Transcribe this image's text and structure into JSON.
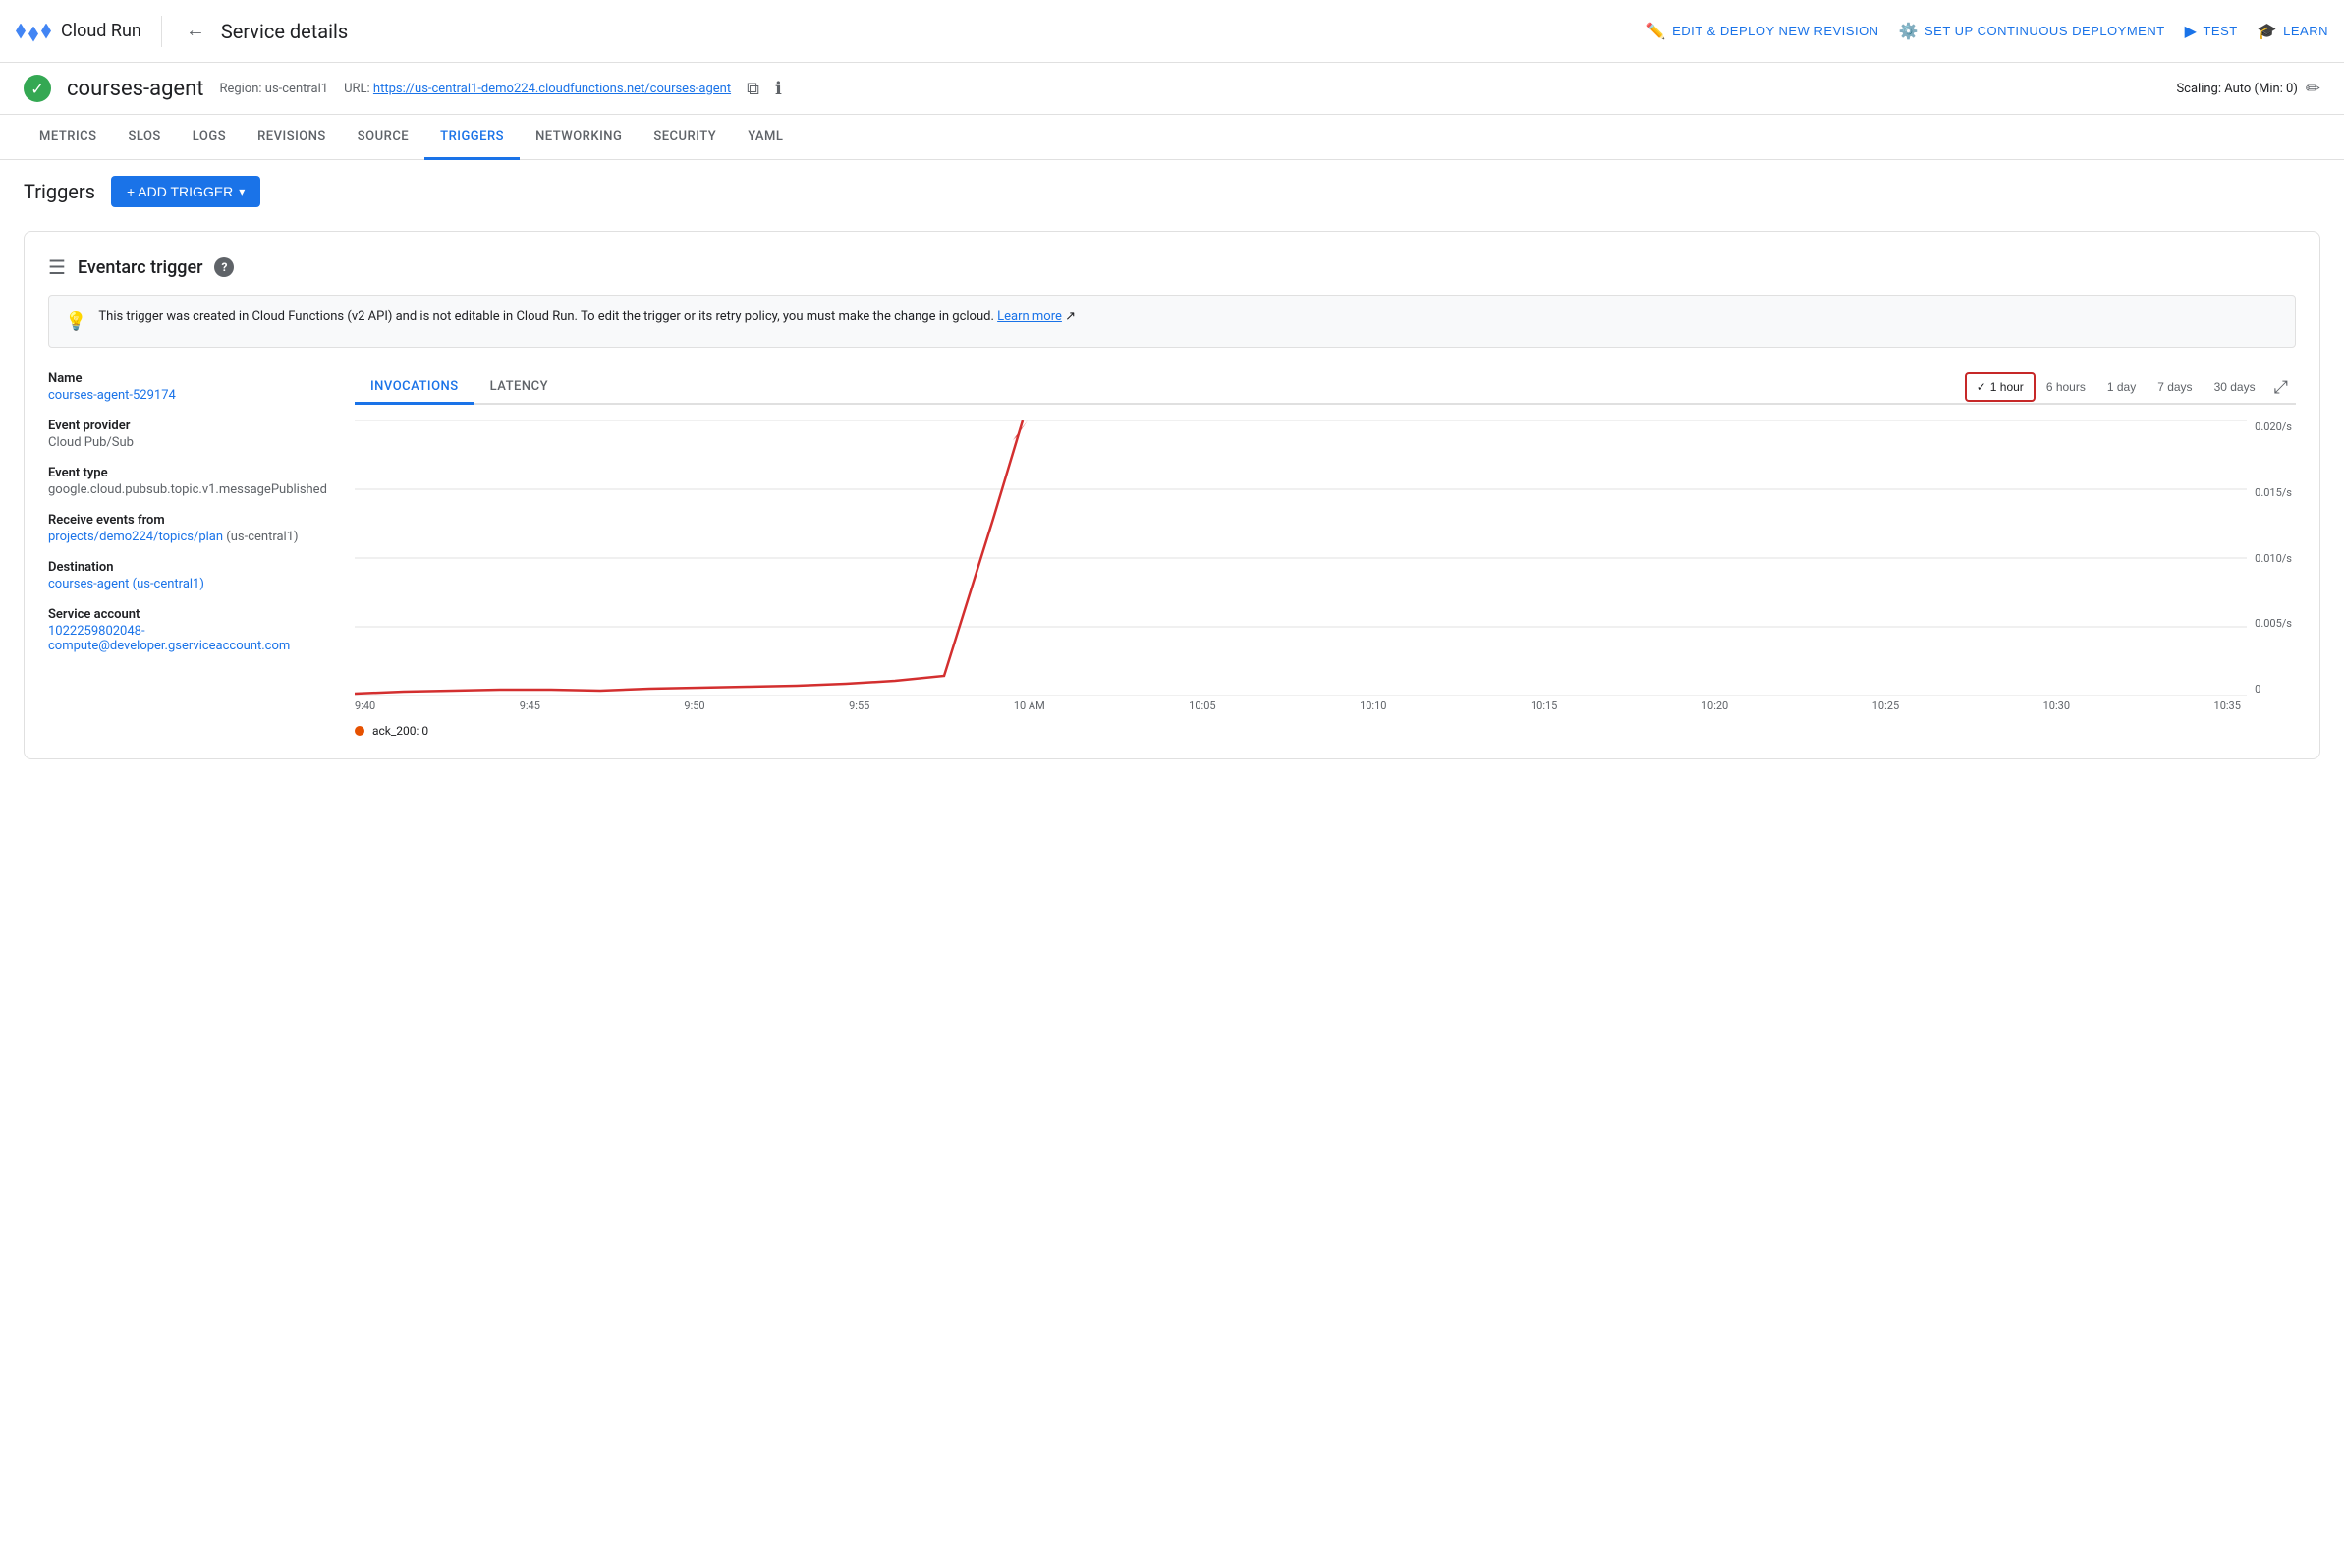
{
  "logo": {
    "name": "Cloud Run"
  },
  "nav": {
    "back_label": "←",
    "page_title": "Service details",
    "actions": [
      {
        "id": "edit-deploy",
        "icon": "✏️",
        "label": "EDIT & DEPLOY NEW REVISION"
      },
      {
        "id": "continuous-deploy",
        "icon": "⚙️",
        "label": "SET UP CONTINUOUS DEPLOYMENT"
      },
      {
        "id": "test",
        "icon": "▶",
        "label": "TEST"
      },
      {
        "id": "learn",
        "icon": "🎓",
        "label": "LEARN"
      }
    ]
  },
  "service": {
    "name": "courses-agent",
    "region_label": "Region:",
    "region": "us-central1",
    "url_label": "URL:",
    "url": "https://us-central1-demo224.cloudfunctions.net/courses-agent",
    "scaling": "Scaling: Auto (Min: 0)"
  },
  "tabs": [
    {
      "id": "metrics",
      "label": "METRICS"
    },
    {
      "id": "slos",
      "label": "SLOS"
    },
    {
      "id": "logs",
      "label": "LOGS"
    },
    {
      "id": "revisions",
      "label": "REVISIONS"
    },
    {
      "id": "source",
      "label": "SOURCE"
    },
    {
      "id": "triggers",
      "label": "TRIGGERS",
      "active": true
    },
    {
      "id": "networking",
      "label": "NETWORKING"
    },
    {
      "id": "security",
      "label": "SECURITY"
    },
    {
      "id": "yaml",
      "label": "YAML"
    }
  ],
  "triggers_section": {
    "title": "Triggers",
    "add_trigger_label": "+ ADD TRIGGER"
  },
  "eventarc_trigger": {
    "title": "Eventarc trigger",
    "info_banner": "This trigger was created in Cloud Functions (v2 API) and is not editable in Cloud Run. To edit the trigger or its retry policy, you must make the change in gcloud.",
    "learn_more": "Learn more",
    "details": {
      "name_label": "Name",
      "name_value": "courses-agent-529174",
      "name_link": "#",
      "event_provider_label": "Event provider",
      "event_provider_value": "Cloud Pub/Sub",
      "event_type_label": "Event type",
      "event_type_value": "google.cloud.pubsub.topic.v1.messagePublished",
      "receive_events_label": "Receive events from",
      "receive_events_link_text": "projects/demo224/topics/plan",
      "receive_events_region": "(us-central1)",
      "destination_label": "Destination",
      "destination_link_text": "courses-agent (us-central1)",
      "service_account_label": "Service account",
      "service_account_link_text": "1022259802048-compute@developer.gserviceaccount.com"
    },
    "chart": {
      "tabs": [
        {
          "id": "invocations",
          "label": "INVOCATIONS",
          "active": true
        },
        {
          "id": "latency",
          "label": "LATENCY"
        }
      ],
      "time_ranges": [
        {
          "id": "1hour",
          "label": "1 hour",
          "active": true,
          "check": true
        },
        {
          "id": "6hours",
          "label": "6 hours"
        },
        {
          "id": "1day",
          "label": "1 day"
        },
        {
          "id": "7days",
          "label": "7 days"
        },
        {
          "id": "30days",
          "label": "30 days"
        }
      ],
      "y_labels": [
        "0.020/s",
        "0.015/s",
        "0.010/s",
        "0.005/s",
        "0"
      ],
      "x_labels": [
        "9:40",
        "9:45",
        "9:50",
        "9:55",
        "10 AM",
        "10:05",
        "10:10",
        "10:15",
        "10:20",
        "10:25",
        "10:30",
        "10:35"
      ],
      "legend": [
        {
          "label": "ack_200: 0",
          "color": "#e65100"
        }
      ]
    }
  }
}
